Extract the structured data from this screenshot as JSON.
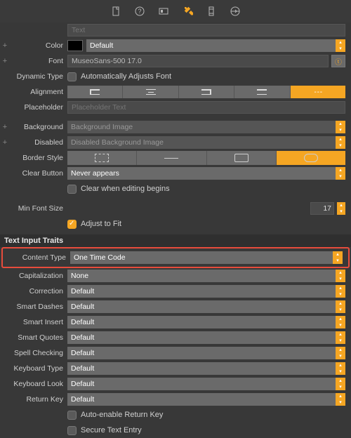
{
  "toolbar_icons": [
    "file",
    "help",
    "identity",
    "attributes",
    "size",
    "connections"
  ],
  "top": {
    "text_label": "",
    "text_placeholder": "Text",
    "color_label": "Color",
    "color_value": "Default",
    "font_label": "Font",
    "font_value": "MuseoSans-500 17.0",
    "dyntype_label": "Dynamic Type",
    "dyntype_check": "Automatically Adjusts Font",
    "alignment_label": "Alignment",
    "alignment_options": [
      "left",
      "center",
      "right",
      "justify",
      "natural"
    ],
    "alignment_selected": 4,
    "placeholder_label": "Placeholder",
    "placeholder_ph": "Placeholder Text",
    "background_label": "Background",
    "background_ph": "Background Image",
    "disabled_label": "Disabled",
    "disabled_ph": "Disabled Background Image",
    "borderstyle_label": "Border Style",
    "clearbutton_label": "Clear Button",
    "clearbutton_value": "Never appears",
    "clearedit_check": "Clear when editing begins",
    "minfont_label": "Min Font Size",
    "minfont_value": "17",
    "adjustfit_check": "Adjust to Fit"
  },
  "traits": {
    "header": "Text Input Traits",
    "content_label": "Content Type",
    "content_value": "One Time Code",
    "cap_label": "Capitalization",
    "cap_value": "None",
    "correction_label": "Correction",
    "correction_value": "Default",
    "dashes_label": "Smart Dashes",
    "dashes_value": "Default",
    "insert_label": "Smart Insert",
    "insert_value": "Default",
    "quotes_label": "Smart Quotes",
    "quotes_value": "Default",
    "spell_label": "Spell Checking",
    "spell_value": "Default",
    "kbtype_label": "Keyboard Type",
    "kbtype_value": "Default",
    "kblook_label": "Keyboard Look",
    "kblook_value": "Default",
    "return_label": "Return Key",
    "return_value": "Default",
    "autoenable_check": "Auto-enable Return Key",
    "secure_check": "Secure Text Entry"
  }
}
